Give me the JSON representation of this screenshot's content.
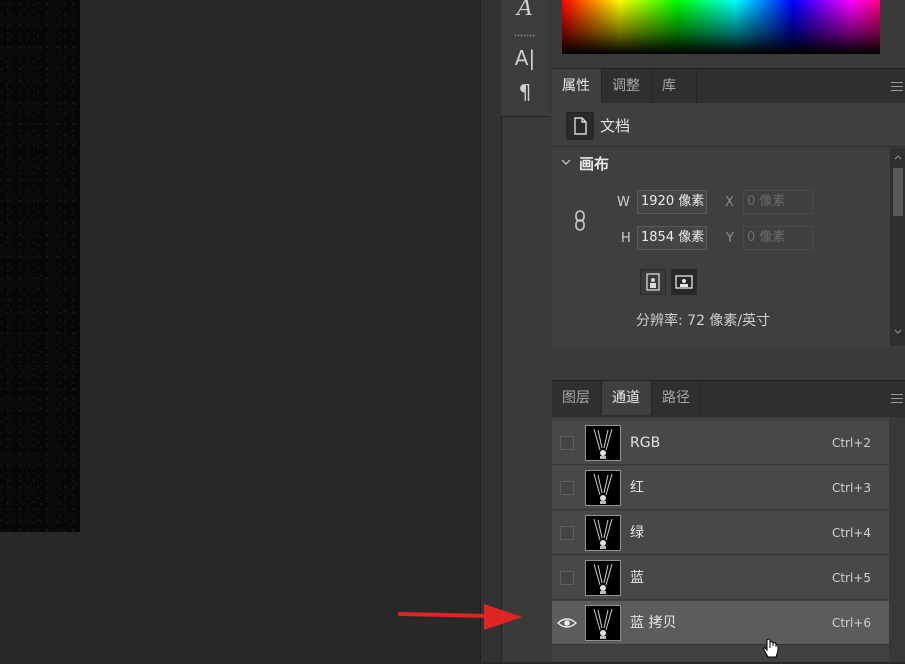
{
  "tool_strip": {
    "glyph_a_italic": "A",
    "glyph_a_cursor": "A|",
    "glyph_para": "¶"
  },
  "properties_panel": {
    "tabs": [
      {
        "label": "属性",
        "active": true
      },
      {
        "label": "调整",
        "active": false
      },
      {
        "label": "库",
        "active": false
      }
    ],
    "doc_label": "文档",
    "canvas_section_title": "画布",
    "width_label": "W",
    "width_value": "1920 像素",
    "height_label": "H",
    "height_value": "1854 像素",
    "x_label": "X",
    "x_value": "0 像素",
    "y_label": "Y",
    "y_value": "0 像素",
    "resolution_text": "分辨率: 72 像素/英寸"
  },
  "channels_panel": {
    "tabs": [
      {
        "label": "图层",
        "active": false
      },
      {
        "label": "通道",
        "active": true
      },
      {
        "label": "路径",
        "active": false
      }
    ],
    "channels": [
      {
        "name": "RGB",
        "shortcut": "Ctrl+2",
        "visible": false,
        "selected": false
      },
      {
        "name": "红",
        "shortcut": "Ctrl+3",
        "visible": false,
        "selected": false
      },
      {
        "name": "绿",
        "shortcut": "Ctrl+4",
        "visible": false,
        "selected": false
      },
      {
        "name": "蓝",
        "shortcut": "Ctrl+5",
        "visible": false,
        "selected": false
      },
      {
        "name": "蓝 拷贝",
        "shortcut": "Ctrl+6",
        "visible": true,
        "selected": true
      }
    ]
  },
  "colors": {
    "accent_arrow": "#e02424",
    "panel_bg": "#3f3f3f",
    "selected_row": "#5c5c5c"
  },
  "icons": [
    "document-icon",
    "link-icon",
    "portrait-icon",
    "landscape-icon",
    "eye-icon",
    "panel-menu-icon",
    "hand-cursor-icon",
    "chevron-down-icon"
  ]
}
